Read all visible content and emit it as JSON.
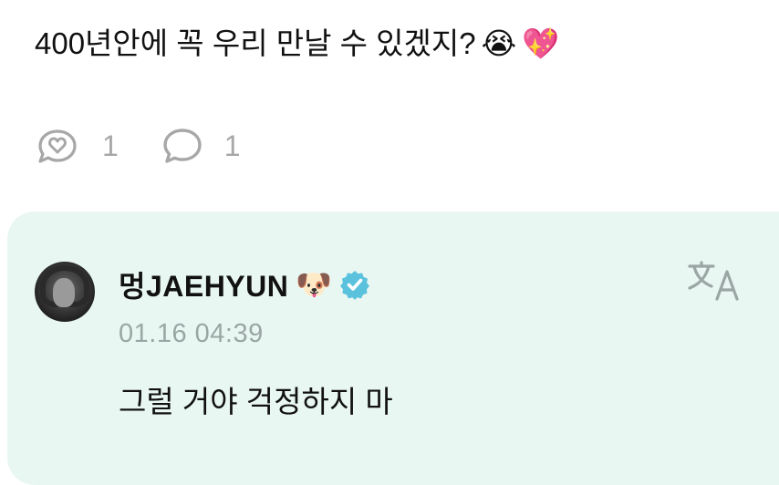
{
  "post": {
    "text": "400년안에 꼭 우리 만날 수 있겠지?",
    "emoji_1": "😭",
    "emoji_2": "💖"
  },
  "actions": {
    "like_count": "1",
    "comment_count": "1"
  },
  "comment": {
    "author": "멍JAEHYUN",
    "author_emoji": "🐶",
    "timestamp": "01.16 04:39",
    "text": "그럴 거야 걱정하지 마"
  },
  "icons": {
    "like": "bubble-heart-icon",
    "comment": "speech-bubble-icon",
    "verified": "verified-badge-icon",
    "translate": "translate-icon"
  },
  "colors": {
    "card_background": "#e9f7f3",
    "muted_text": "#9aa6a4",
    "verified": "#5bc2dd",
    "icon_gray": "#a7a7a7"
  }
}
